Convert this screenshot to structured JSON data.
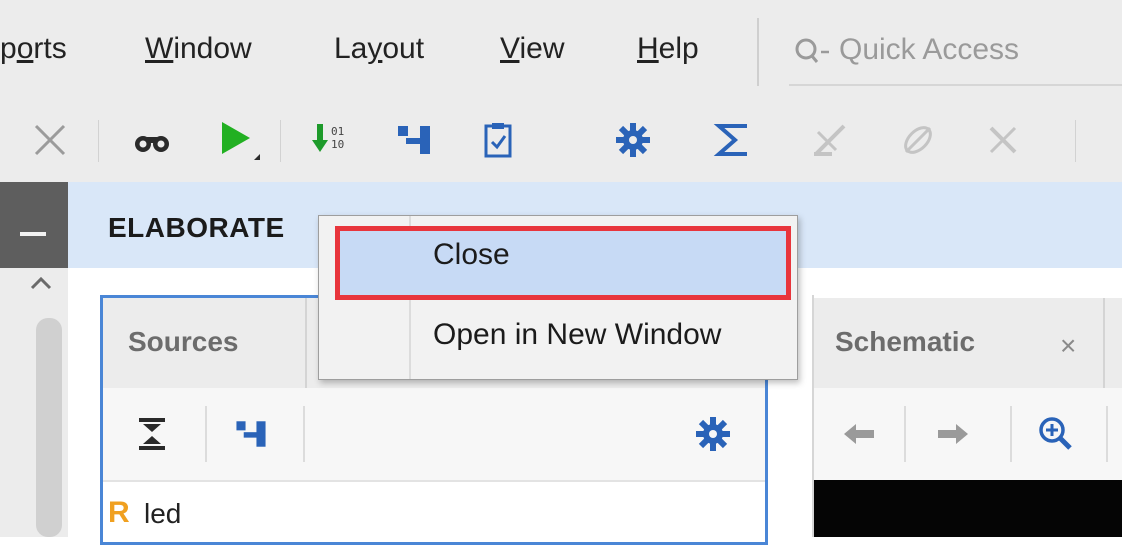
{
  "menubar": {
    "items": [
      {
        "label": "ports",
        "mnemonic": "o"
      },
      {
        "label": "Window",
        "mnemonic": "W"
      },
      {
        "label": "Layout",
        "mnemonic": "y"
      },
      {
        "label": "View",
        "mnemonic": "V"
      },
      {
        "label": "Help",
        "mnemonic": "H"
      }
    ],
    "quick_access_placeholder": "Quick Access"
  },
  "toolbar": {
    "buttons": [
      "close-icon",
      "binoculars-icon",
      "run-icon",
      "download-bitstream-icon",
      "hierarchy-icon",
      "report-icon",
      "gear-icon",
      "sigma-icon",
      "disabled-tool-icon",
      "disabled-tool-icon",
      "disabled-tool-icon"
    ],
    "colors": {
      "run": "#22b022",
      "download": "#1d9a2a",
      "blue_icon": "#2a63b8",
      "disabled": "#c0c0c0"
    }
  },
  "header": {
    "title": "ELABORATE"
  },
  "sources_panel": {
    "tab_label": "Sources",
    "tree_items": [
      {
        "icon": "R",
        "label": "led"
      }
    ],
    "border_color": "#4a86d6"
  },
  "schematic_panel": {
    "tab_label": "Schematic",
    "close_glyph": "×"
  },
  "context_menu": {
    "items": [
      {
        "label": "Close",
        "highlighted": true
      },
      {
        "label": "Open in New Window",
        "highlighted": false
      }
    ],
    "highlight_color": "#c7daf5",
    "annotation_color": "#e8353c"
  }
}
